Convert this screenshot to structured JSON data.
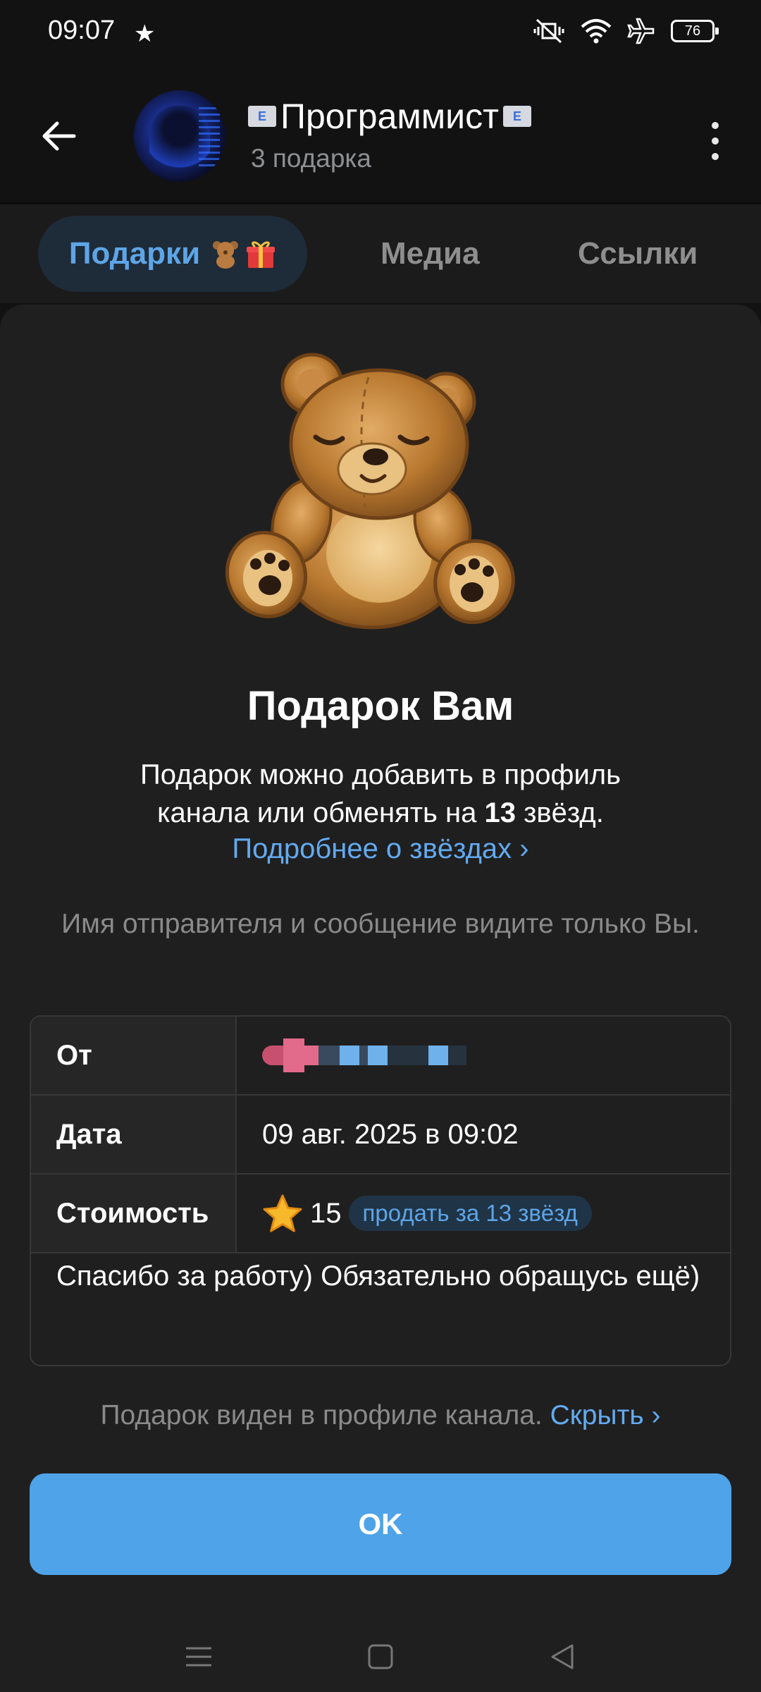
{
  "status_bar": {
    "time": "09:07",
    "battery": "76",
    "icons": [
      "star-icon",
      "vibrate-off-icon",
      "wifi-icon",
      "airplane-icon",
      "battery-icon"
    ]
  },
  "header": {
    "title": "Программист",
    "subtitle": "3 подарка",
    "title_emoji": "envelope-e-mail-emoji"
  },
  "tabs": [
    {
      "label": "Подарки",
      "active": true,
      "emoji": [
        "teddy-bear-emoji",
        "gift-emoji"
      ]
    },
    {
      "label": "Медиа",
      "active": false
    },
    {
      "label": "Ссылки",
      "active": false
    }
  ],
  "gift": {
    "title": "Подарок Вам",
    "desc_line1": "Подарок можно добавить в профиль",
    "desc_line2_pre": "канала или обменять на ",
    "desc_line2_bold": "13",
    "desc_line2_post": " звёзд.",
    "more_link": "Подробнее о звёздах ›",
    "note": "Имя отправителя и сообщение видите только Вы."
  },
  "info_table": {
    "from_label": "От",
    "date_label": "Дата",
    "date_value": "09 авг. 2025 в 09:02",
    "cost_label": "Стоимость",
    "cost_value": "15",
    "sell_label": "продать за 13 звёзд",
    "message": "Спасибо за работу) Обязательно обращусь ещё)"
  },
  "visibility": {
    "text": "Подарок виден в профиле канала. ",
    "link": "Скрыть ›"
  },
  "ok_button": "OK",
  "colors": {
    "accent": "#4fa3e8",
    "link": "#63aaf0",
    "sheet_bg": "#1f1f1f",
    "page_bg": "#121212"
  }
}
